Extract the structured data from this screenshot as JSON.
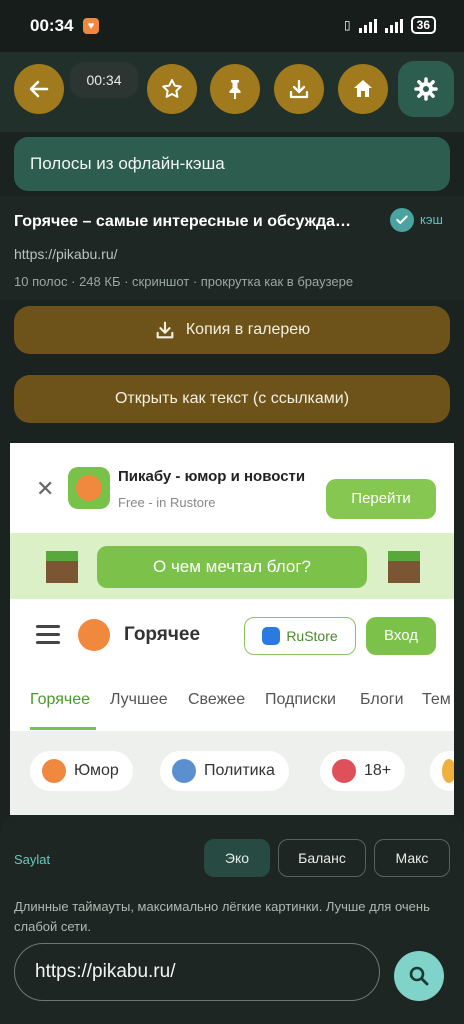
{
  "status_bar": {
    "time": "00:34",
    "battery": "36"
  },
  "toolbar": {
    "time_chip": "00:34",
    "icons": [
      "back-arrow-icon",
      "star-icon",
      "pin-icon",
      "download-icon",
      "home-icon",
      "gear-icon"
    ]
  },
  "offline_banner": "Полосы из офлайн-кэша",
  "card": {
    "title": "Горячее – самые интересные и обсужда…",
    "cache_label": "кэш",
    "url": "https://pikabu.ru/",
    "meta": "10 полос · 248 КБ · скриншот · прокрутка как в браузере"
  },
  "actions": {
    "copy_to_gallery": "Копия в галерею",
    "open_as_text": "Открыть как текст (с ссылками)"
  },
  "preview": {
    "app_title": "Пикабу - юмор и новости",
    "app_subtitle": "Free - in Rustore",
    "go_button": "Перейти",
    "blog_button": "О чем мечтал блог?",
    "header_title": "Горячее",
    "rustore_label": "RuStore",
    "login_button": "Вход",
    "tabs": [
      "Горячее",
      "Лучшее",
      "Свежее",
      "Подписки",
      "Блоги",
      "Тем"
    ],
    "chips": [
      "Юмор",
      "Политика",
      "18+"
    ]
  },
  "bottom": {
    "label": "Saylat",
    "modes": [
      "Эко",
      "Баланс",
      "Макс"
    ],
    "active_mode": "Эко",
    "description": "Длинные таймауты, максимально лёгкие картинки. Лучше для очень слабой сети.",
    "url_value": "https://pikabu.ru/"
  }
}
